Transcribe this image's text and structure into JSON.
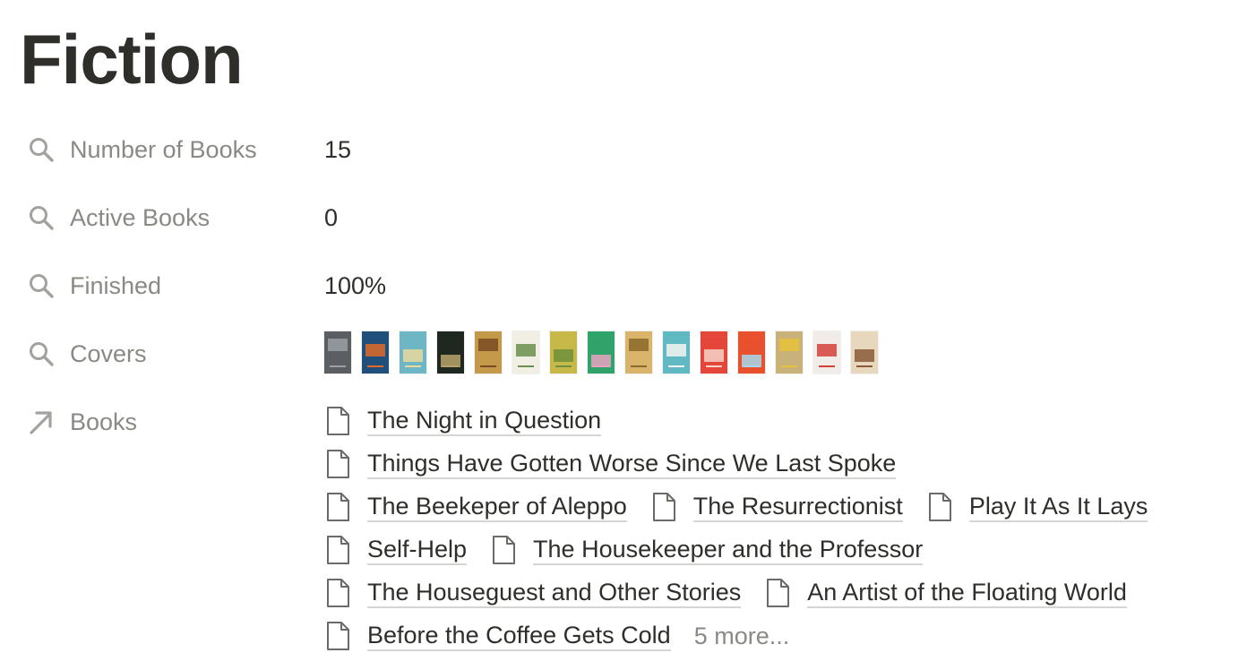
{
  "page": {
    "title": "Fiction"
  },
  "properties": {
    "number_of_books": {
      "label": "Number of Books",
      "icon": "search-icon",
      "value": "15"
    },
    "active_books": {
      "label": "Active Books",
      "icon": "search-icon",
      "value": "0"
    },
    "finished": {
      "label": "Finished",
      "icon": "search-icon",
      "value": "100%"
    },
    "covers": {
      "label": "Covers",
      "icon": "search-icon",
      "items": [
        {
          "color": "#5b5f63",
          "accent": "#9aa0a3"
        },
        {
          "color": "#1f4f7a",
          "accent": "#e06a2a"
        },
        {
          "color": "#6fb6c4",
          "accent": "#e9d9a0"
        },
        {
          "color": "#1e2720",
          "accent": "#b8a46a"
        },
        {
          "color": "#c49a4a",
          "accent": "#7a4b22"
        },
        {
          "color": "#f1efe4",
          "accent": "#6a8f4e"
        },
        {
          "color": "#c7b84a",
          "accent": "#6f8f3a"
        },
        {
          "color": "#2fa36a",
          "accent": "#e8a3c0"
        },
        {
          "color": "#d9b46a",
          "accent": "#8a6a2a"
        },
        {
          "color": "#5fb8c2",
          "accent": "#f4f4f0"
        },
        {
          "color": "#e5463a",
          "accent": "#f6d4c8"
        },
        {
          "color": "#e8502e",
          "accent": "#a6d8ec"
        },
        {
          "color": "#c9b27a",
          "accent": "#e7c23a"
        },
        {
          "color": "#f1ece8",
          "accent": "#d2413a"
        },
        {
          "color": "#e7d7bd",
          "accent": "#8a5a3a"
        }
      ]
    },
    "books": {
      "label": "Books",
      "icon": "arrow-up-right-icon",
      "lines": [
        [
          "The Night in Question"
        ],
        [
          "Things Have Gotten Worse Since We Last Spoke"
        ],
        [
          "The Beekeper of Aleppo",
          "The Resurrectionist",
          "Play It As It Lays"
        ],
        [
          "Self-Help",
          "The Housekeeper and the Professor"
        ],
        [
          "The Houseguest and Other Stories",
          "An Artist of the Floating World"
        ],
        [
          "Before the Coffee Gets Cold"
        ]
      ],
      "more_label": "5 more..."
    }
  }
}
